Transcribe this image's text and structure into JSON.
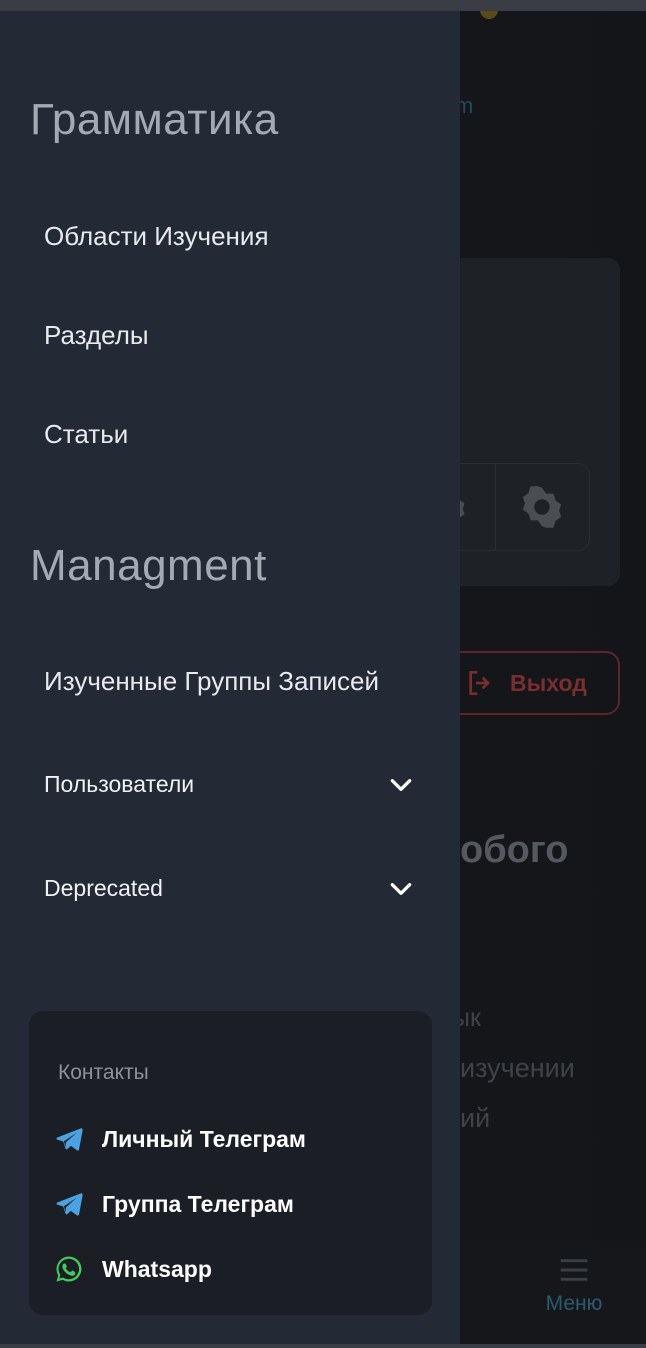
{
  "drawer": {
    "sections": [
      {
        "title": "Грамматика",
        "items": [
          "Области Изучения",
          "Разделы",
          "Статьи"
        ]
      },
      {
        "title": "Managment",
        "items": [
          "Изученные Группы Записей"
        ],
        "expandable": [
          "Пользователи",
          "Deprecated"
        ]
      }
    ]
  },
  "contacts": {
    "title": "Контакты",
    "items": [
      {
        "label": "Личный Телеграм",
        "icon": "telegram-icon"
      },
      {
        "label": "Группа Телеграм",
        "icon": "telegram-icon"
      },
      {
        "label": "Whatsapp",
        "icon": "whatsapp-icon"
      }
    ]
  },
  "background": {
    "link_fragment": "m",
    "logout_label": "Выход",
    "heading_fragment": "обого",
    "text_fragments": [
      "ык",
      "изучении",
      "ий"
    ],
    "menu_label": "Меню"
  },
  "colors": {
    "drawer_bg": "#242936",
    "contacts_bg": "#1b1e24",
    "telegram": "#4aa3e0",
    "whatsapp": "#3ecf5a",
    "logout": "#7a2e2e"
  }
}
